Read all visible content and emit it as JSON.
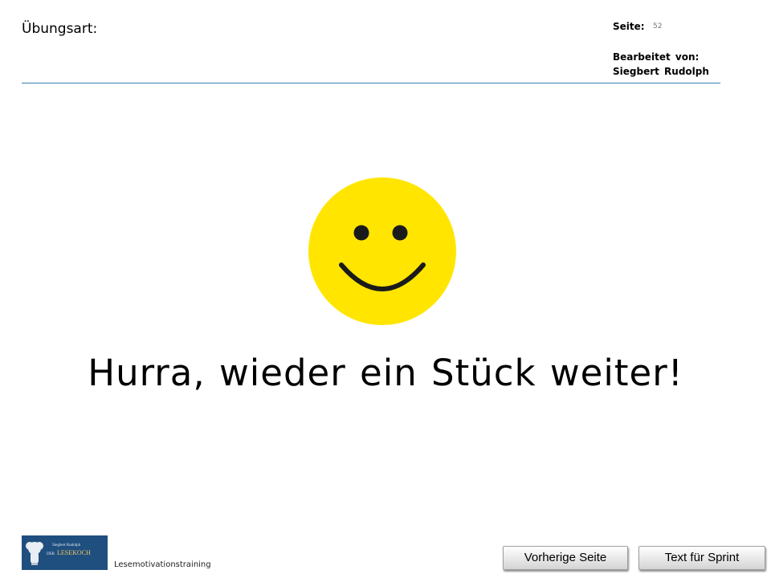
{
  "header": {
    "exercise_type_label": "Übungsart:",
    "page_label": "Seite:",
    "page_number": "52",
    "edited_by_label": "Bearbeitet von:",
    "editor_name": "Siegbert Rudolph"
  },
  "main": {
    "icon": "smiley-face-icon",
    "message": "Hurra, wieder ein Stück weiter!"
  },
  "footer": {
    "logo_author": "Siegbert Rudolph",
    "logo_prefix": "DER",
    "logo_brand": "LESEKOCH",
    "program_name": "Lesemotivationstraining",
    "prev_button": "Vorherige Seite",
    "next_button": "Text für Sprint"
  },
  "colors": {
    "accent_line": "#3a7fae",
    "smiley_yellow": "#ffe500",
    "logo_background": "#1f4f7f"
  }
}
